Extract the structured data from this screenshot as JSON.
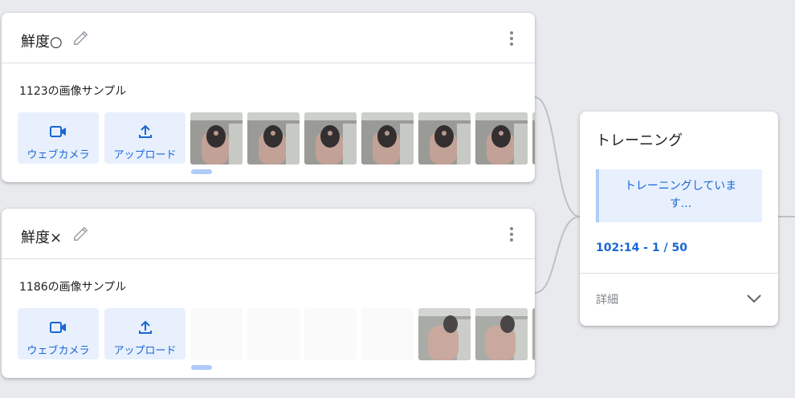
{
  "classes": [
    {
      "name": "鮮度○",
      "sample_count": "1123の画像サンプル",
      "webcam_label": "ウェブカメラ",
      "upload_label": "アップロード",
      "thumbnails": [
        "person-hand",
        "person-hand",
        "person-hand",
        "person-hand",
        "person-hand",
        "person-hand",
        "person-hand"
      ]
    },
    {
      "name": "鮮度×",
      "sample_count": "1186の画像サンプル",
      "webcam_label": "ウェブカメラ",
      "upload_label": "アップロード",
      "thumbnails": [
        "blank",
        "blank",
        "blank",
        "blank",
        "hand",
        "hand",
        "hand"
      ]
    }
  ],
  "training": {
    "title": "トレーニング",
    "status": "トレーニングしています...",
    "status_line1": "トレーニングしていま",
    "status_line2": "す...",
    "progress": "102:14 - 1 / 50",
    "details_label": "詳細"
  },
  "icons": {
    "edit": "pencil-icon",
    "menu": "more-vert-icon",
    "webcam": "videocam-icon",
    "upload": "upload-icon",
    "expand": "chevron-down-icon"
  },
  "colors": {
    "background": "#e8eaed",
    "accent": "#1967d2",
    "button_bg": "#e8f0fe",
    "scroll_indicator": "#aecbfa"
  }
}
